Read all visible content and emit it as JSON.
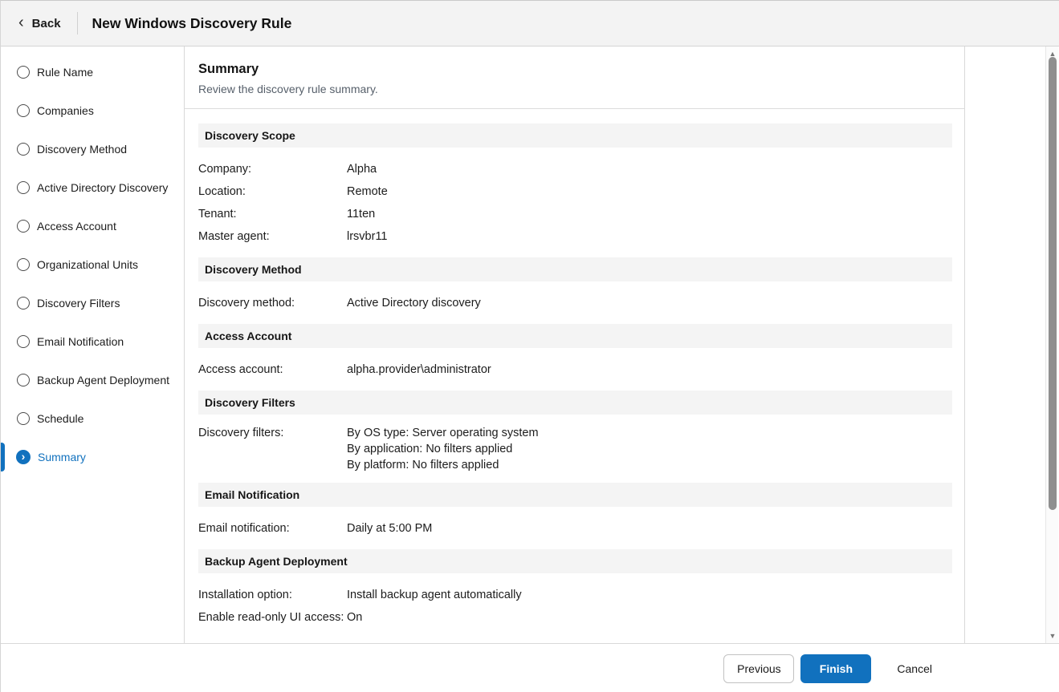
{
  "topbar": {
    "back_label": "Back",
    "title": "New Windows Discovery Rule"
  },
  "icons": {
    "back_chevron": "‹",
    "active_step_chevron": "›",
    "scroll_up": "▲",
    "scroll_down": "▼"
  },
  "sidebar": {
    "steps": [
      {
        "label": "Rule Name",
        "active": false
      },
      {
        "label": "Companies",
        "active": false
      },
      {
        "label": "Discovery Method",
        "active": false
      },
      {
        "label": "Active Directory Discovery",
        "active": false
      },
      {
        "label": "Access Account",
        "active": false
      },
      {
        "label": "Organizational Units",
        "active": false
      },
      {
        "label": "Discovery Filters",
        "active": false
      },
      {
        "label": "Email Notification",
        "active": false
      },
      {
        "label": "Backup Agent Deployment",
        "active": false
      },
      {
        "label": "Schedule",
        "active": false
      },
      {
        "label": "Summary",
        "active": true
      }
    ]
  },
  "main": {
    "title": "Summary",
    "subtitle": "Review the discovery rule summary.",
    "sections": [
      {
        "title": "Discovery Scope",
        "rows": [
          {
            "label": "Company:",
            "values": [
              "Alpha"
            ]
          },
          {
            "label": "Location:",
            "values": [
              "Remote"
            ]
          },
          {
            "label": "Tenant:",
            "values": [
              "11ten"
            ]
          },
          {
            "label": "Master agent:",
            "values": [
              "lrsvbr11"
            ]
          }
        ]
      },
      {
        "title": "Discovery Method",
        "rows": [
          {
            "label": "Discovery method:",
            "values": [
              "Active Directory discovery"
            ]
          }
        ]
      },
      {
        "title": "Access Account",
        "rows": [
          {
            "label": "Access account:",
            "values": [
              "alpha.provider\\administrator"
            ]
          }
        ]
      },
      {
        "title": "Discovery Filters",
        "rows": [
          {
            "label": "Discovery filters:",
            "values": [
              "By OS type: Server operating system",
              "By application: No filters applied",
              "By platform: No filters applied"
            ]
          }
        ]
      },
      {
        "title": "Email Notification",
        "rows": [
          {
            "label": "Email notification:",
            "values": [
              "Daily at 5:00 PM"
            ]
          }
        ]
      },
      {
        "title": "Backup Agent Deployment",
        "rows": [
          {
            "label": "Installation option:",
            "values": [
              "Install backup agent automatically"
            ]
          },
          {
            "label": "Enable read-only UI access:",
            "values": [
              "On"
            ]
          }
        ]
      }
    ]
  },
  "footer": {
    "previous_label": "Previous",
    "finish_label": "Finish",
    "cancel_label": "Cancel"
  },
  "colors": {
    "accent_blue": "#1171be",
    "topbar_bg": "#f3f3f3",
    "section_band_bg": "#f4f4f4"
  }
}
